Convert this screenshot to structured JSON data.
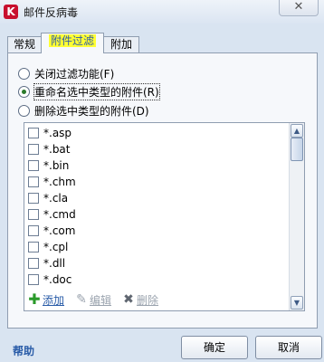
{
  "window": {
    "title": "邮件反病毒",
    "close_symbol": "✕",
    "app_icon_letter": "K"
  },
  "tabs": [
    {
      "label": "常规",
      "active": false
    },
    {
      "label": "附件过滤",
      "active": true
    },
    {
      "label": "附加",
      "active": false
    }
  ],
  "filter_options": [
    {
      "label": "关闭过滤功能(F)",
      "checked": false
    },
    {
      "label": "重命名选中类型的附件(R)",
      "checked": true
    },
    {
      "label": "删除选中类型的附件(D)",
      "checked": false
    }
  ],
  "extensions": [
    "*.asp",
    "*.bat",
    "*.bin",
    "*.chm",
    "*.cla",
    "*.cmd",
    "*.com",
    "*.cpl",
    "*.dll",
    "*.doc"
  ],
  "list_toolbar": {
    "add": {
      "label": "添加",
      "icon": "plus-icon",
      "enabled": true
    },
    "edit": {
      "label": "编辑",
      "icon": "pencil-icon",
      "enabled": false
    },
    "delete": {
      "label": "删除",
      "icon": "x-icon",
      "enabled": false
    }
  },
  "footer": {
    "help": "帮助",
    "ok": "确定",
    "cancel": "取消"
  },
  "colors": {
    "tab_highlight": "#ffff33",
    "link": "#2a5ca8",
    "accent_green": "#2a9a2a"
  }
}
